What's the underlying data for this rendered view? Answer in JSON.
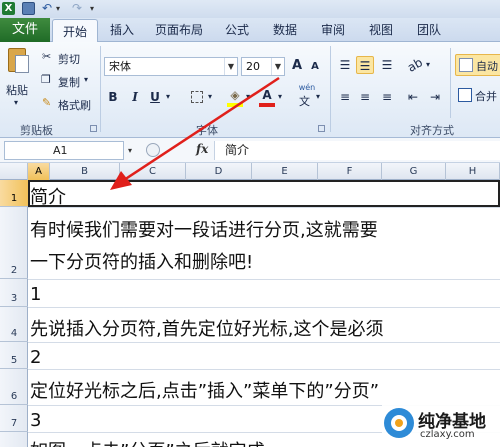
{
  "quick_access": {
    "icons": [
      "excel-icon",
      "save-icon",
      "undo-icon",
      "redo-icon"
    ]
  },
  "tabs": {
    "file": "文件",
    "home": "开始",
    "insert": "插入",
    "page_layout": "页面布局",
    "formulas": "公式",
    "data": "数据",
    "review": "审阅",
    "view": "视图",
    "team": "团队"
  },
  "ribbon": {
    "clipboard": {
      "paste": "粘贴",
      "cut": "剪切",
      "copy": "复制",
      "format_painter": "格式刷",
      "label": "剪贴板"
    },
    "font": {
      "name": "宋体",
      "size": "20",
      "label": "字体",
      "increase": "A",
      "decrease": "A",
      "bold": "B",
      "italic": "I",
      "underline": "U",
      "phonetic": "wén"
    },
    "alignment": {
      "label": "对齐方式",
      "wrap": "自动",
      "merge": "合并"
    }
  },
  "formula_bar": {
    "name_box": "A1",
    "fx": "fx",
    "content": "简介"
  },
  "sheet": {
    "columns": [
      "A",
      "B",
      "C",
      "D",
      "E",
      "F",
      "G",
      "H"
    ],
    "rows": [
      "1",
      "2",
      "3",
      "4",
      "5",
      "6",
      "7"
    ],
    "cells": {
      "r1": "简介",
      "r2a": "有时候我们需要对一段话进行分页,这就需要",
      "r2b": "一下分页符的插入和删除吧!",
      "r3": "1",
      "r4": "先说插入分页符,首先定位好光标,这个是必须",
      "r5": "2",
      "r6": "定位好光标之后,点击”插入”菜单下的”分页”",
      "r7": "3",
      "r8": "如图，点击”分页”之后就完成"
    }
  },
  "watermark": {
    "title": "纯净基地",
    "url": "czlaxy.com"
  },
  "colors": {
    "file_tab": "#2a7a32",
    "arrow": "#e0201b",
    "selection": "#f1c15a"
  }
}
